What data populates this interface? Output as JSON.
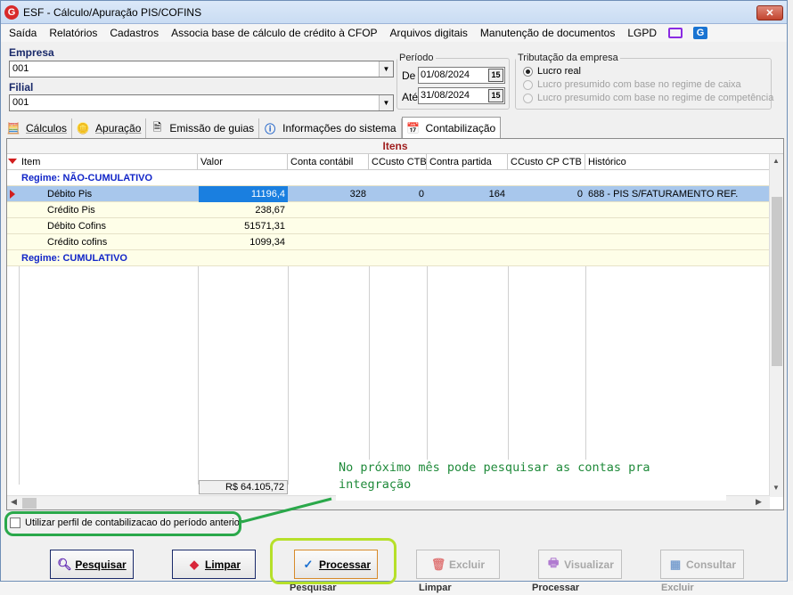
{
  "window": {
    "title": "ESF - Cálculo/Apuração PIS/COFINS",
    "close_label": "✕"
  },
  "menu": [
    "Saída",
    "Relatórios",
    "Cadastros",
    "Associa base de cálculo de crédito à CFOP",
    "Arquivos digitais",
    "Manutenção de documentos",
    "LGPD"
  ],
  "form": {
    "empresa_label": "Empresa",
    "empresa_value": "001",
    "filial_label": "Filial",
    "filial_value": "001",
    "periodo_label": "Período",
    "de_label": "De",
    "de_value": "01/08/2024",
    "ate_label": "Até",
    "ate_value": "31/08/2024",
    "calendar_glyph": "15",
    "tributacao_label": "Tributação da empresa",
    "options": [
      "Lucro real",
      "Lucro presumido com base no regime de caixa",
      "Lucro presumido com base no regime de competência"
    ]
  },
  "tabs": [
    "Cálculos",
    "Apuração",
    "Emissão de guias",
    "Informações do sistema",
    "Contabilização"
  ],
  "grid": {
    "caption": "Itens",
    "columns": [
      "Item",
      "Valor",
      "Conta contábil",
      "CCusto CTB",
      "Contra partida",
      "CCusto CP CTB",
      "Histórico"
    ],
    "rows": [
      {
        "item": "Regime: NÃO-CUMULATIVO",
        "valor": "",
        "conta": "",
        "ccusto": "",
        "contra": "",
        "ccustocp": "",
        "historico": ""
      },
      {
        "item": "Débito Pis",
        "valor": "11196,4",
        "conta": "328",
        "ccusto": "0",
        "contra": "164",
        "ccustocp": "0",
        "historico": "688 - PIS S/FATURAMENTO REF."
      },
      {
        "item": "Crédito Pis",
        "valor": "238,67",
        "conta": "",
        "ccusto": "",
        "contra": "",
        "ccustocp": "",
        "historico": ""
      },
      {
        "item": "Débito Cofins",
        "valor": "51571,31",
        "conta": "",
        "ccusto": "",
        "contra": "",
        "ccustocp": "",
        "historico": ""
      },
      {
        "item": "Crédito cofins",
        "valor": "1099,34",
        "conta": "",
        "ccusto": "",
        "contra": "",
        "ccustocp": "",
        "historico": ""
      },
      {
        "item": "Regime: CUMULATIVO",
        "valor": "",
        "conta": "",
        "ccusto": "",
        "contra": "",
        "ccustocp": "",
        "historico": ""
      }
    ],
    "total": "R$ 64.105,72"
  },
  "annotation": {
    "line1": "No próximo mês pode pesquisar as contas pra",
    "line2": "integração"
  },
  "checkbox_label": "Utilizar perfil de contabilizacao do período anterior",
  "buttons": {
    "pesquisar": "Pesquisar",
    "limpar": "Limpar",
    "processar": "Processar",
    "excluir": "Excluir",
    "visualizar": "Visualizar",
    "consultar": "Consultar"
  },
  "background_ghost": {
    "pesquisar": "Pesquisar",
    "limpar": "Limpar",
    "processar": "Processar",
    "excluir": "Excluir"
  },
  "colors": {
    "selected_row": "#a8c7ec",
    "selected_value": "#1a7fe0",
    "group_text": "#1226c8",
    "annotation": "#1f8a3a",
    "highlight_oval": "#b6e02a"
  }
}
